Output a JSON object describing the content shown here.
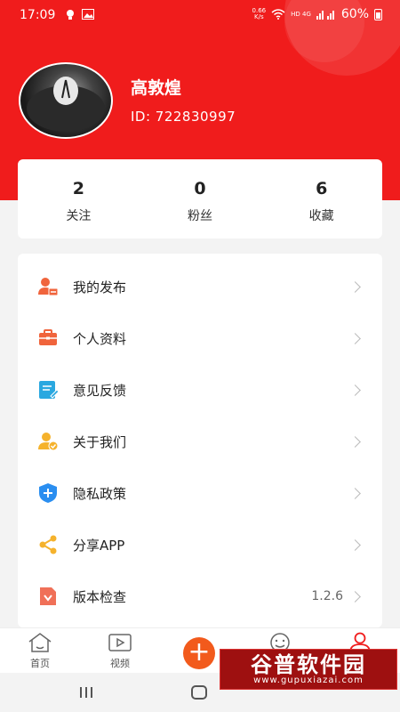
{
  "status_bar": {
    "time": "17:09",
    "speed_value": "0.66",
    "speed_unit": "K/s",
    "network": "HD 4G",
    "battery": "60%"
  },
  "profile": {
    "name": "高敦煌",
    "id": "ID: 722830997"
  },
  "stats": [
    {
      "value": "2",
      "label": "关注"
    },
    {
      "value": "0",
      "label": "粉丝"
    },
    {
      "value": "6",
      "label": "收藏"
    }
  ],
  "menu": [
    {
      "label": "我的发布",
      "icon": "user-post-icon"
    },
    {
      "label": "个人资料",
      "icon": "toolbox-icon"
    },
    {
      "label": "意见反馈",
      "icon": "feedback-edit-icon"
    },
    {
      "label": "关于我们",
      "icon": "user-check-icon"
    },
    {
      "label": "隐私政策",
      "icon": "shield-plus-icon"
    },
    {
      "label": "分享APP",
      "icon": "share-icon"
    },
    {
      "label": "版本检查",
      "icon": "version-doc-icon",
      "value": "1.2.6"
    }
  ],
  "tabbar": {
    "home": "首页",
    "video": "视频",
    "add": "+"
  },
  "watermark": {
    "title": "谷普软件园",
    "url": "www.gupuxiazai.com"
  },
  "colors": {
    "brand_red": "#f01c1c",
    "fab_orange": "#f25a1c"
  }
}
